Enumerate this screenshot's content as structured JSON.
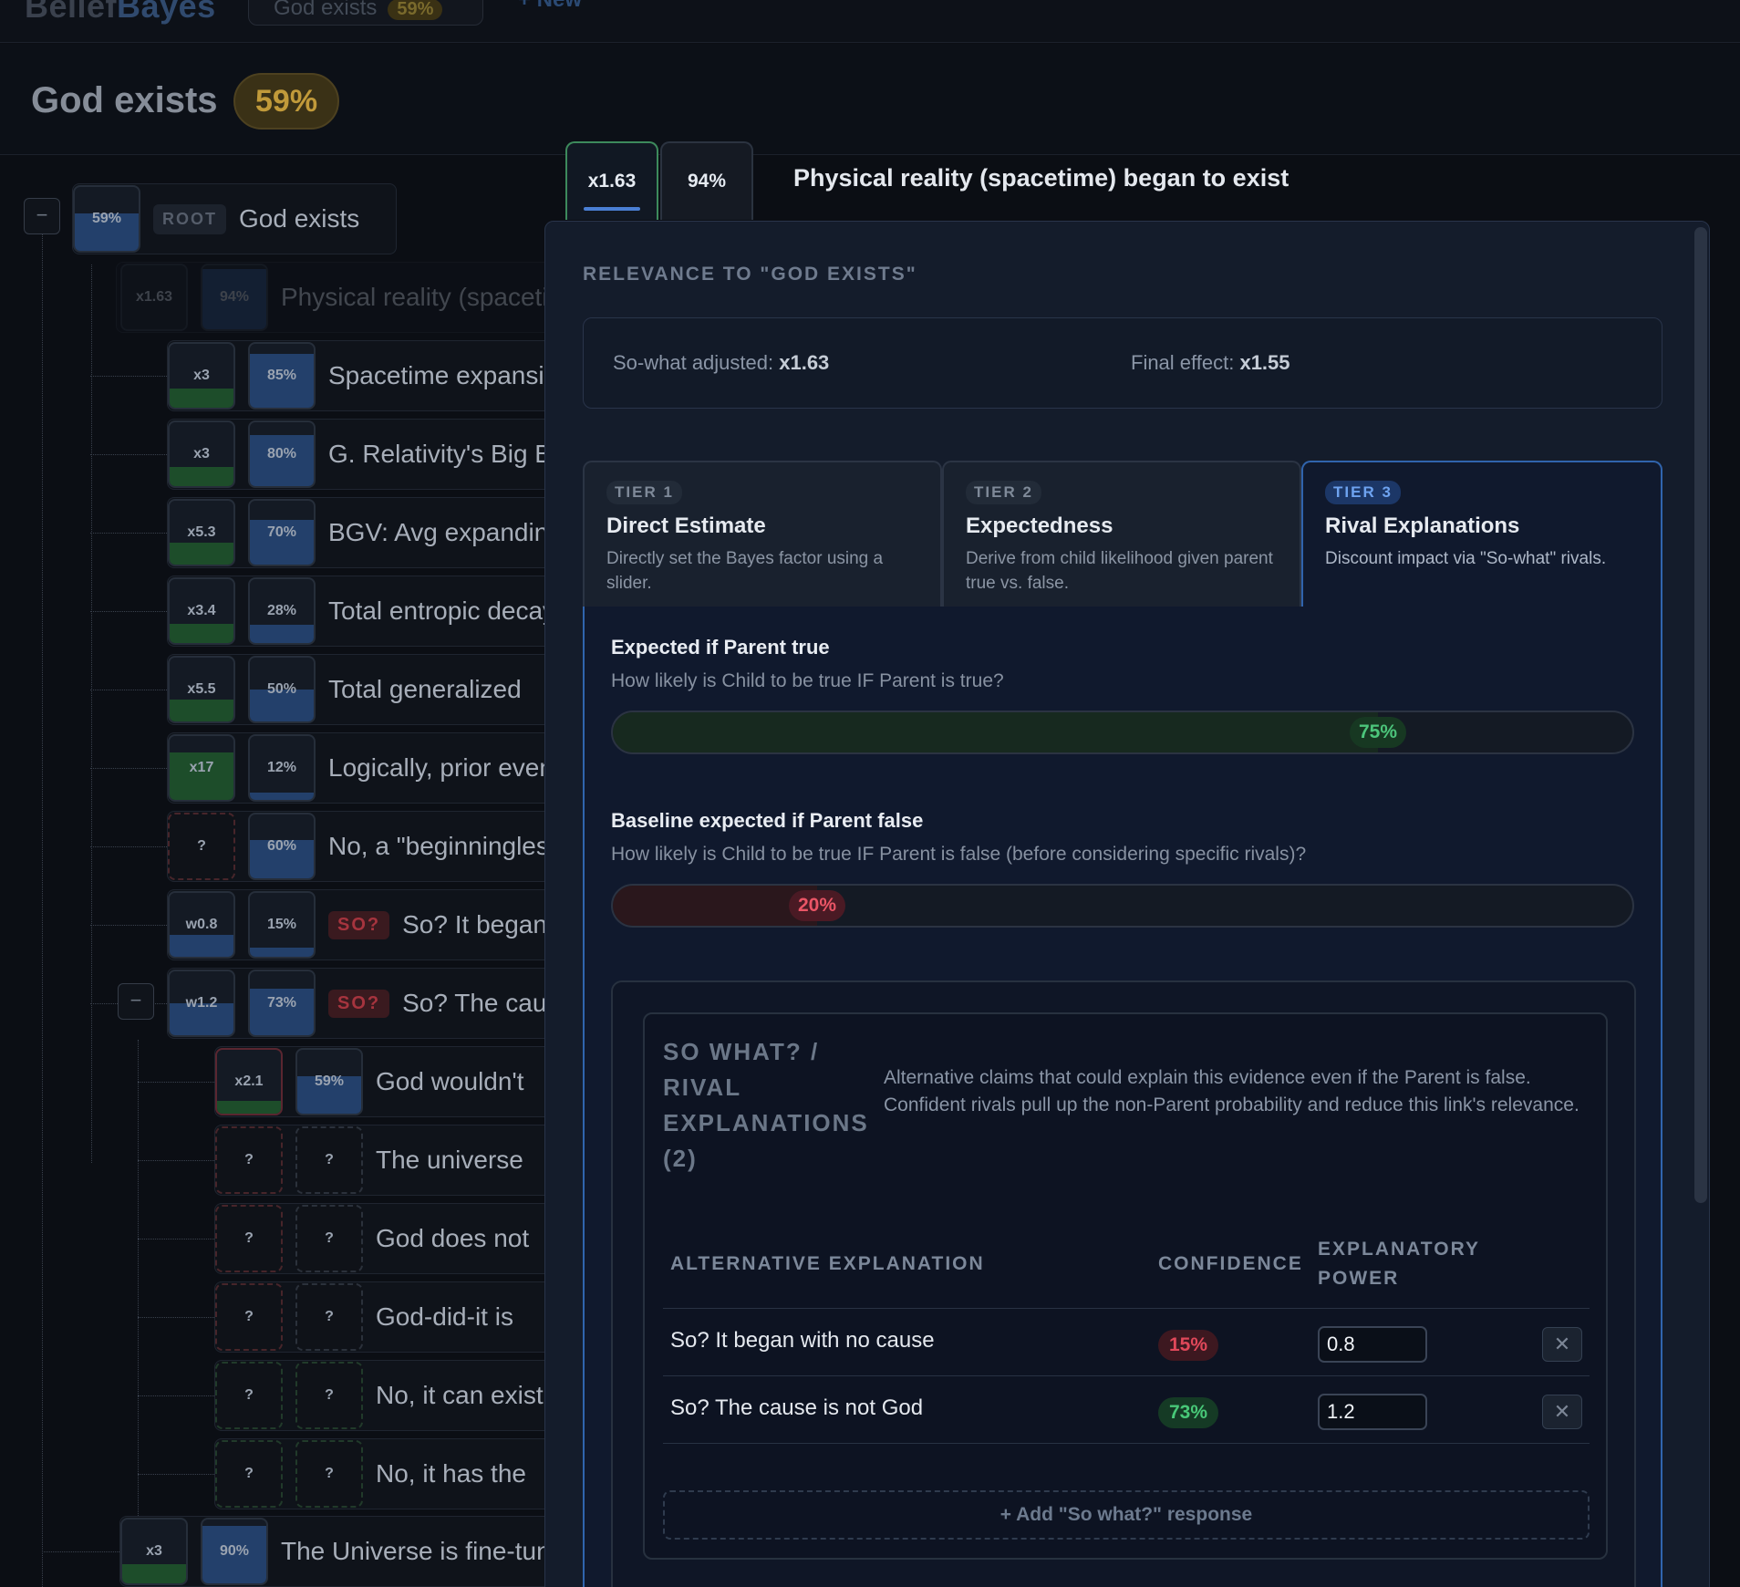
{
  "app": {
    "brand_a": "Belief",
    "brand_b": "Bayes",
    "tab_label": "God exists",
    "tab_badge": "59%",
    "new_label": "+ New"
  },
  "header": {
    "title": "God exists",
    "probability": "59%"
  },
  "tree": {
    "root": {
      "tag": "ROOT",
      "label": "God exists",
      "prob": "59%",
      "prob_level": 0.59
    },
    "collapse_symbol": "−",
    "selected": {
      "factor": "x1.63",
      "prob": "94%",
      "label": "Physical reality (spacetime) began to exist"
    },
    "children": [
      {
        "factor": "x3",
        "prob": "85%",
        "label": "Spacetime expansion",
        "prob_level": 0.85,
        "factor_level": 0.3
      },
      {
        "factor": "x3",
        "prob": "80%",
        "label": "G. Relativity's Big Bang",
        "prob_level": 0.8,
        "factor_level": 0.3
      },
      {
        "factor": "x5.3",
        "prob": "70%",
        "label": "BGV: Avg expanding",
        "prob_level": 0.7,
        "factor_level": 0.35
      },
      {
        "factor": "x3.4",
        "prob": "28%",
        "label": "Total entropic decay",
        "prob_level": 0.28,
        "factor_level": 0.3
      },
      {
        "factor": "x5.5",
        "prob": "50%",
        "label": "Total generalized",
        "prob_level": 0.5,
        "factor_level": 0.35
      },
      {
        "factor": "x17",
        "prob": "12%",
        "label": "Logically, prior events",
        "prob_level": 0.12,
        "factor_level": 0.75
      },
      {
        "factor": "?",
        "prob": "60%",
        "label": "No, a \"beginningless\"",
        "prob_level": 0.6,
        "factor_level": 0
      },
      {
        "factor": "w0.8",
        "prob": "15%",
        "label": "So? It began with no cause",
        "so_tag": "SO?",
        "prob_level": 0.15,
        "factor_level": 0.35
      },
      {
        "factor": "w1.2",
        "prob": "73%",
        "label": "So? The cause is not God",
        "so_tag": "SO?",
        "prob_level": 0.73,
        "factor_level": 0.5
      }
    ],
    "grandchildren": [
      {
        "factor": "x2.1",
        "prob": "59%",
        "label": "God wouldn't",
        "prob_level": 0.59,
        "factor_level": 0.2
      },
      {
        "factor": "?",
        "prob": "?",
        "label": "The universe",
        "style": "red"
      },
      {
        "factor": "?",
        "prob": "?",
        "label": "God does not",
        "style": "red"
      },
      {
        "factor": "?",
        "prob": "?",
        "label": "God-did-it is",
        "style": "red"
      },
      {
        "factor": "?",
        "prob": "?",
        "label": "No, it can exist",
        "style": "green"
      },
      {
        "factor": "?",
        "prob": "?",
        "label": "No, it has the",
        "style": "green"
      }
    ],
    "sibling": {
      "factor": "x3",
      "prob": "90%",
      "label": "The Universe is fine-tuned",
      "prob_level": 0.9,
      "factor_level": 0.3
    }
  },
  "modal": {
    "tab_factor": "x1.63",
    "tab_prob": "94%",
    "heading": "Physical reality (spacetime) began to exist",
    "relevance_label": "RELEVANCE TO \"GOD EXISTS\"",
    "so_what_label": "So-what adjusted:",
    "so_what_value": "x1.63",
    "final_label": "Final effect:",
    "final_value": "x1.55",
    "tiers": [
      {
        "tag": "TIER 1",
        "title": "Direct Estimate",
        "desc": "Directly set the Bayes factor using a slider."
      },
      {
        "tag": "TIER 2",
        "title": "Expectedness",
        "desc": "Derive from child likelihood given parent true vs. false."
      },
      {
        "tag": "TIER 3",
        "title": "Rival Explanations",
        "desc": "Discount impact via \"So-what\" rivals."
      }
    ],
    "active_tier": 3,
    "expected_true": {
      "label": "Expected if Parent true",
      "help": "How likely is Child to be true IF Parent is true?",
      "value": "75%",
      "level": 0.75
    },
    "expected_false": {
      "label": "Baseline expected if Parent false",
      "help": "How likely is Child to be true IF Parent is false (before considering specific rivals)?",
      "value": "20%",
      "level": 0.2
    },
    "rivals": {
      "title": "SO WHAT? / RIVAL EXPLANATIONS (2)",
      "desc": "Alternative claims that could explain this evidence even if the Parent is false. Confident rivals pull up the non-Parent probability and reduce this link's relevance.",
      "col_alt": "ALTERNATIVE EXPLANATION",
      "col_conf": "CONFIDENCE",
      "col_power": "EXPLANATORY POWER",
      "rows": [
        {
          "label": "So? It began with no cause",
          "confidence": "15%",
          "confidence_color": "#e0485a",
          "power": "0.8"
        },
        {
          "label": "So? The cause is not God",
          "confidence": "73%",
          "confidence_color": "#48c878",
          "power": "1.2"
        }
      ],
      "add_label": "+ Add \"So what?\" response",
      "delete_symbol": "✕"
    }
  },
  "colors": {
    "accent_gold": "#c19a3a",
    "accent_blue": "#3064ad",
    "positive": "#48c878",
    "negative": "#e0485a"
  }
}
